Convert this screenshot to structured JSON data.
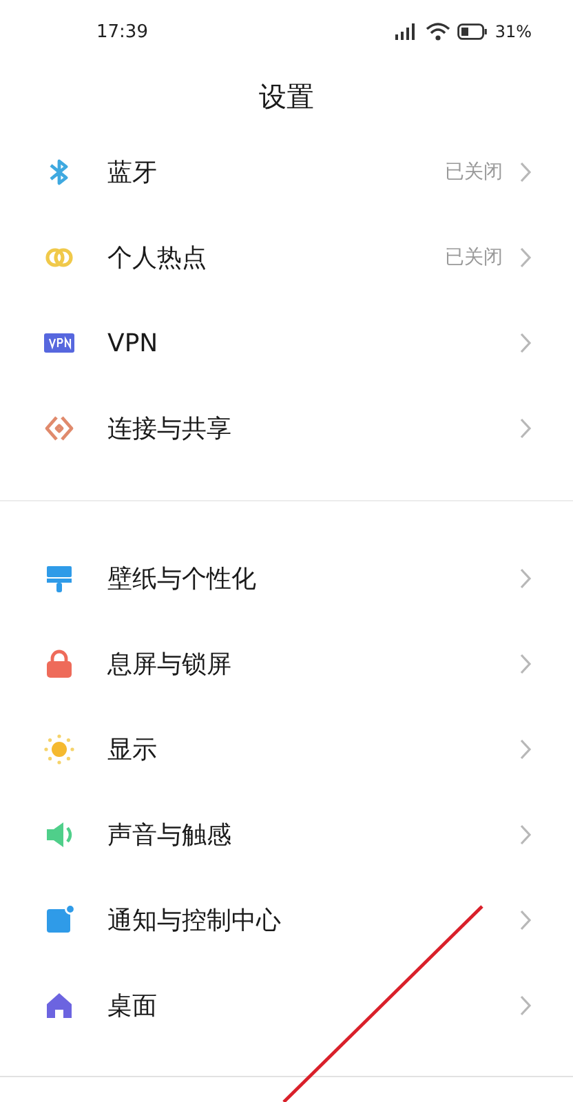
{
  "status_bar": {
    "time": "17:39",
    "battery": "31%"
  },
  "title": "设置",
  "sections": [
    {
      "items": [
        {
          "label": "蓝牙",
          "value": "已关闭"
        },
        {
          "label": "个人热点",
          "value": "已关闭"
        },
        {
          "label": "VPN"
        },
        {
          "label": "连接与共享"
        }
      ]
    },
    {
      "items": [
        {
          "label": "壁纸与个性化"
        },
        {
          "label": "息屏与锁屏"
        },
        {
          "label": "显示"
        },
        {
          "label": "声音与触感"
        },
        {
          "label": "通知与控制中心"
        },
        {
          "label": "桌面"
        }
      ]
    }
  ]
}
